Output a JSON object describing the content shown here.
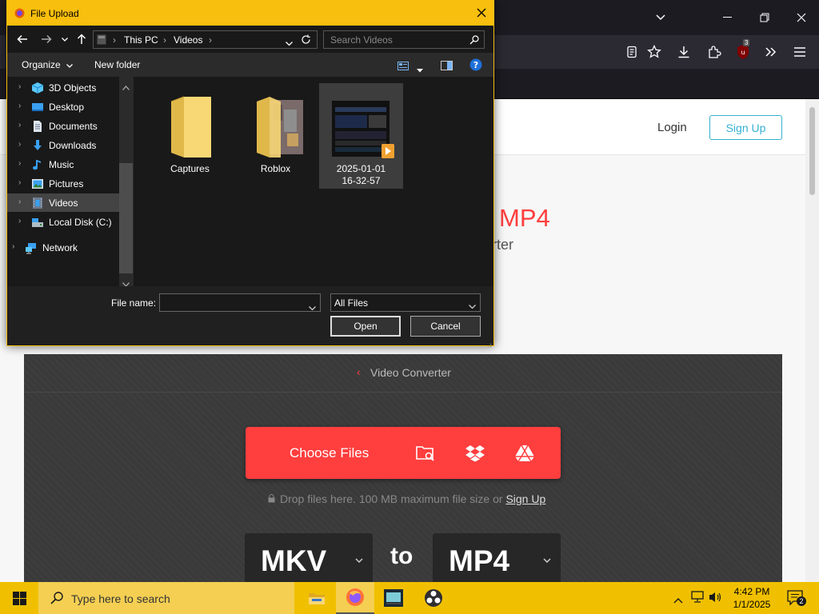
{
  "dialog": {
    "title": "File Upload",
    "address": {
      "root": "This PC",
      "folder": "Videos"
    },
    "search_placeholder": "Search Videos",
    "commands": {
      "organize": "Organize",
      "new_folder": "New folder"
    },
    "nav_items": [
      {
        "label": "3D Objects",
        "icon": "cube-icon"
      },
      {
        "label": "Desktop",
        "icon": "desktop-icon"
      },
      {
        "label": "Documents",
        "icon": "documents-icon"
      },
      {
        "label": "Downloads",
        "icon": "download-arrow-icon"
      },
      {
        "label": "Music",
        "icon": "music-note-icon"
      },
      {
        "label": "Pictures",
        "icon": "pictures-icon"
      },
      {
        "label": "Videos",
        "icon": "videos-icon",
        "selected": true
      },
      {
        "label": "Local Disk (C:)",
        "icon": "disk-icon"
      },
      {
        "label": "Network",
        "icon": "network-icon"
      }
    ],
    "files": [
      {
        "name": "Captures",
        "type": "folder"
      },
      {
        "name": "Roblox",
        "type": "folder"
      },
      {
        "name": "2025-01-01 16-32-57",
        "line1": "2025-01-01",
        "line2": "16-32-57",
        "type": "video",
        "selected": true
      }
    ],
    "file_name_label": "File name:",
    "file_name_value": "",
    "file_type": "All Files",
    "open_label": "Open",
    "cancel_label": "Cancel"
  },
  "site": {
    "login": "Login",
    "signup": "Sign Up",
    "hero_title": "MP4",
    "hero_subtitle": "erter",
    "breadcrumb": "Video Converter",
    "choose_files": "Choose Files",
    "drop_hint": "Drop files here. 100 MB maximum file size or",
    "drop_signup": "Sign Up",
    "from_format": "MKV",
    "to_label": "to",
    "to_format": "MP4",
    "accent_color": "#ff3e3e"
  },
  "browser": {
    "extension_badge": "3"
  },
  "taskbar": {
    "search_placeholder": "Type here to search",
    "time": "4:42 PM",
    "date": "1/1/2025",
    "notification_count": "2"
  }
}
